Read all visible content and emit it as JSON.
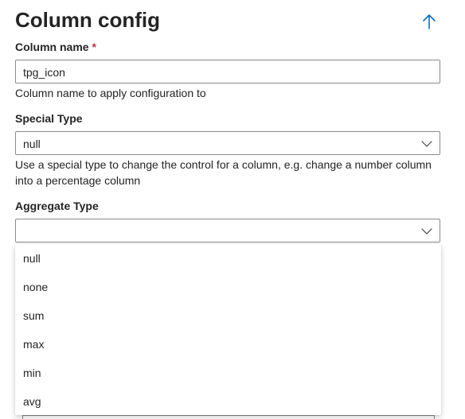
{
  "panel": {
    "title": "Column config"
  },
  "column_name": {
    "label": "Column name",
    "required_mark": "*",
    "value": "tpg_icon",
    "help": "Column name to apply configuration to"
  },
  "special_type": {
    "label": "Special Type",
    "selected": "null",
    "help": "Use a special type to change the control for a column, e.g. change a number column into a percentage column"
  },
  "aggregate_type": {
    "label": "Aggregate Type",
    "selected": "",
    "options": [
      "null",
      "none",
      "sum",
      "max",
      "min",
      "avg"
    ]
  },
  "icons": {
    "up": "arrow-up-icon",
    "chevron": "chevron-down-icon"
  },
  "colors": {
    "accent": "#0f6cbd",
    "required": "#c4314b",
    "border": "#8a8a8a",
    "text": "#242424"
  }
}
